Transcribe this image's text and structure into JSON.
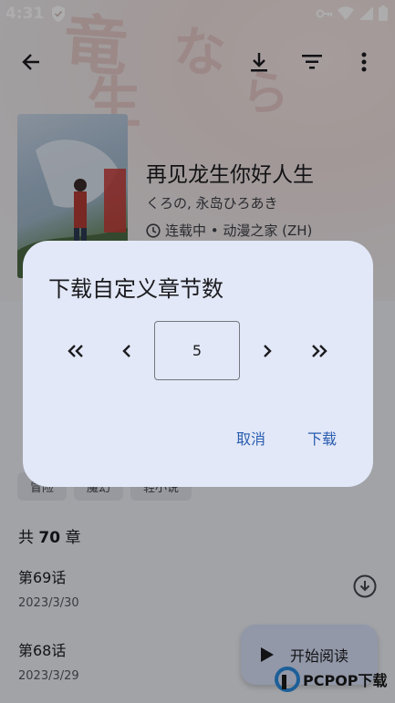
{
  "status_bar": {
    "time": "4:31"
  },
  "manga": {
    "title": "再见龙生你好人生",
    "authors": "くろの, 永岛ひろあき",
    "status_line": "连载中 • 动漫之家 (ZH)",
    "tags": [
      "冒险",
      "魔幻",
      "轻小说"
    ],
    "chapter_count_prefix": "共",
    "chapter_count": "70",
    "chapter_count_suffix": "章",
    "chapters": [
      {
        "name": "第69话",
        "date": "2023/3/30"
      },
      {
        "name": "第68话",
        "date": "2023/3/29"
      }
    ]
  },
  "fab": {
    "label": "开始阅读"
  },
  "dialog": {
    "title": "下载自定义章节数",
    "value": "5",
    "cancel": "取消",
    "confirm": "下载"
  },
  "watermark": {
    "text": "PCPOP下载"
  },
  "colors": {
    "accent": "#2a5db0",
    "dialog_bg": "#e2e8f7",
    "fab_bg": "#d7e0f8"
  }
}
